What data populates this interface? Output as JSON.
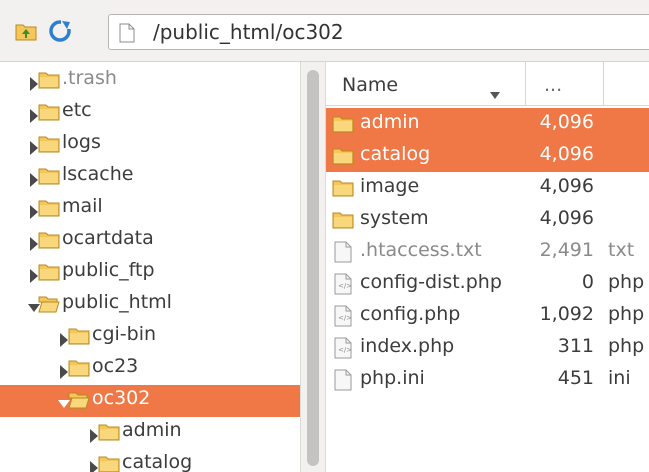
{
  "toolbar": {
    "path": "/public_html/oc302",
    "up_icon": "folder-up-icon",
    "refresh_icon": "refresh-icon"
  },
  "colors": {
    "selection": "#f07746",
    "folder_fill": "#f5c65a",
    "folder_stroke": "#b88a1e"
  },
  "tree": {
    "items": [
      {
        "label": ".trash",
        "expanded": false,
        "level": 0,
        "selected": false,
        "dim": true
      },
      {
        "label": "etc",
        "expanded": false,
        "level": 0,
        "selected": false,
        "dim": false
      },
      {
        "label": "logs",
        "expanded": false,
        "level": 0,
        "selected": false,
        "dim": false
      },
      {
        "label": "lscache",
        "expanded": false,
        "level": 0,
        "selected": false,
        "dim": false
      },
      {
        "label": "mail",
        "expanded": false,
        "level": 0,
        "selected": false,
        "dim": false
      },
      {
        "label": "ocartdata",
        "expanded": false,
        "level": 0,
        "selected": false,
        "dim": false
      },
      {
        "label": "public_ftp",
        "expanded": false,
        "level": 0,
        "selected": false,
        "dim": false
      },
      {
        "label": "public_html",
        "expanded": true,
        "level": 0,
        "selected": false,
        "dim": false
      },
      {
        "label": "cgi-bin",
        "expanded": false,
        "level": 1,
        "selected": false,
        "dim": false
      },
      {
        "label": "oc23",
        "expanded": false,
        "level": 1,
        "selected": false,
        "dim": false
      },
      {
        "label": "oc302",
        "expanded": true,
        "level": 1,
        "selected": true,
        "dim": false
      },
      {
        "label": "admin",
        "expanded": false,
        "level": 2,
        "selected": false,
        "dim": false
      },
      {
        "label": "catalog",
        "expanded": false,
        "level": 2,
        "selected": false,
        "dim": false
      }
    ]
  },
  "list": {
    "columns": {
      "name": "Name",
      "size": "...",
      "type": ""
    },
    "rows": [
      {
        "name": "admin",
        "size": "4,096",
        "type": "",
        "kind": "folder",
        "selected": true,
        "dim": false
      },
      {
        "name": "catalog",
        "size": "4,096",
        "type": "",
        "kind": "folder",
        "selected": true,
        "dim": false
      },
      {
        "name": "image",
        "size": "4,096",
        "type": "",
        "kind": "folder",
        "selected": false,
        "dim": false
      },
      {
        "name": "system",
        "size": "4,096",
        "type": "",
        "kind": "folder",
        "selected": false,
        "dim": false
      },
      {
        "name": ".htaccess.txt",
        "size": "2,491",
        "type": "txt",
        "kind": "doc",
        "selected": false,
        "dim": true
      },
      {
        "name": "config-dist.php",
        "size": "0",
        "type": "php",
        "kind": "php",
        "selected": false,
        "dim": false
      },
      {
        "name": "config.php",
        "size": "1,092",
        "type": "php",
        "kind": "php",
        "selected": false,
        "dim": false
      },
      {
        "name": "index.php",
        "size": "311",
        "type": "php",
        "kind": "php",
        "selected": false,
        "dim": false
      },
      {
        "name": "php.ini",
        "size": "451",
        "type": "ini",
        "kind": "doc",
        "selected": false,
        "dim": false
      }
    ]
  }
}
